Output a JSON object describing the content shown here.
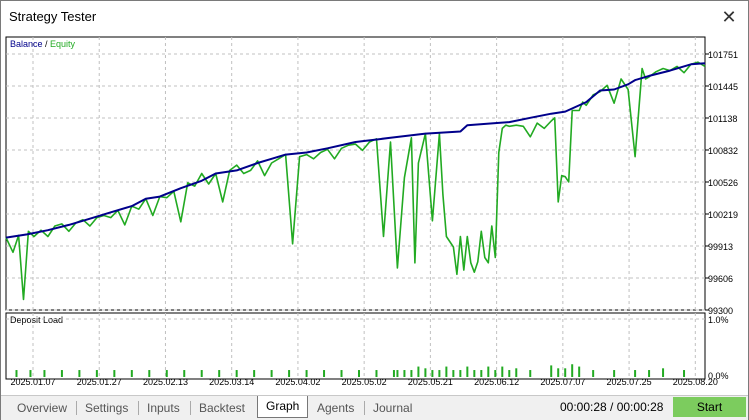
{
  "window": {
    "title": "Strategy Tester",
    "close_glyph": "✕"
  },
  "colors": {
    "balance": "#00008b",
    "equity": "#22aa22",
    "deposit_load": "#22aa22",
    "grid": "#c0c0c0",
    "start_button": "#7ccc5e"
  },
  "tabs": [
    {
      "label": "Overview",
      "active": false
    },
    {
      "label": "Settings",
      "active": false
    },
    {
      "label": "Inputs",
      "active": false
    },
    {
      "label": "Backtest",
      "active": false
    },
    {
      "label": "Graph",
      "active": true
    },
    {
      "label": "Agents",
      "active": false
    },
    {
      "label": "Journal",
      "active": false
    }
  ],
  "status": {
    "timer": "00:00:28 / 00:00:28",
    "start_label": "Start"
  },
  "chart_data": [
    {
      "type": "line",
      "legend": [
        {
          "name": "Balance",
          "color": "#00008b"
        },
        {
          "name": "Equity",
          "color": "#22aa22"
        }
      ],
      "legend_separator": " / ",
      "ylim": [
        99300,
        101900
      ],
      "yticks": [
        "101751",
        "101445",
        "101138",
        "100832",
        "100526",
        "100219",
        "99913",
        "99606",
        "99300"
      ],
      "xticks": [
        "2025.01.07",
        "2025.01.27",
        "2025.02.13",
        "2025.03.14",
        "2025.04.02",
        "2025.05.02",
        "2025.05.21",
        "2025.06.12",
        "2025.07.07",
        "2025.07.25",
        "2025.08.20"
      ],
      "grid": true,
      "xrange": [
        0,
        100
      ],
      "series": [
        {
          "name": "Balance",
          "x": [
            0,
            3,
            6,
            9,
            12,
            15,
            18,
            20,
            22,
            25,
            28,
            30,
            33,
            36,
            38,
            40,
            43,
            46,
            50,
            55,
            60,
            65,
            66,
            70,
            72,
            75,
            78,
            80,
            83,
            85,
            87,
            89,
            90,
            92,
            95,
            98,
            100
          ],
          "values": [
            99990,
            100020,
            100060,
            100110,
            100170,
            100230,
            100290,
            100360,
            100380,
            100460,
            100530,
            100600,
            100630,
            100700,
            100740,
            100780,
            100800,
            100840,
            100900,
            100940,
            100980,
            101000,
            101060,
            101080,
            101090,
            101130,
            101170,
            101190,
            101280,
            101390,
            101400,
            101450,
            101490,
            101530,
            101580,
            101640,
            101650
          ]
        },
        {
          "name": "Equity",
          "x": [
            0,
            1,
            1.8,
            2.5,
            3.2,
            4,
            5,
            6,
            7,
            8,
            9,
            10,
            11,
            12,
            13,
            14,
            15,
            16,
            17,
            18,
            19,
            20,
            21,
            22,
            23,
            24,
            25,
            26,
            27,
            28,
            29,
            30,
            31,
            32,
            33,
            34,
            35,
            36,
            37,
            38,
            39,
            40,
            41,
            42,
            43,
            44,
            45,
            46,
            47,
            48,
            49,
            50,
            51,
            52,
            53,
            54,
            55,
            56,
            57,
            58,
            58.5,
            59,
            60,
            61,
            62,
            62.5,
            63,
            64,
            64.5,
            65,
            65.5,
            66,
            66.5,
            67,
            67.5,
            68,
            68.5,
            69,
            69.5,
            70,
            70.5,
            71,
            71.5,
            72,
            73,
            74,
            75,
            76,
            77,
            78,
            78.5,
            79,
            79.5,
            80,
            80.5,
            81,
            82,
            82.5,
            83,
            84,
            85,
            86,
            87,
            88,
            89,
            90,
            91,
            91.5,
            92,
            93,
            94,
            95,
            96,
            97,
            98,
            99,
            100
          ],
          "values": [
            99990,
            99850,
            100010,
            99400,
            100050,
            100000,
            100060,
            100000,
            100100,
            100120,
            100050,
            100130,
            100160,
            100100,
            100180,
            100200,
            100180,
            100250,
            100110,
            100290,
            100260,
            100360,
            100200,
            100380,
            100370,
            100430,
            100140,
            100510,
            100480,
            100600,
            100500,
            100600,
            100330,
            100630,
            100680,
            100600,
            100630,
            100720,
            100580,
            100700,
            100740,
            100780,
            99930,
            100760,
            100780,
            100740,
            100800,
            100830,
            100740,
            100840,
            100870,
            100880,
            100820,
            100900,
            100930,
            100000,
            100900,
            99700,
            100560,
            100940,
            99750,
            100700,
            100980,
            100150,
            100980,
            100400,
            100000,
            99900,
            99640,
            100000,
            99680,
            100000,
            99750,
            99660,
            99760,
            100050,
            99800,
            99750,
            100100,
            99800,
            100800,
            101030,
            101060,
            101050,
            101060,
            101050,
            100950,
            101080,
            101030,
            101100,
            101130,
            100330,
            100580,
            100570,
            100520,
            101200,
            101200,
            101280,
            101250,
            101350,
            101380,
            101440,
            101270,
            101500,
            101400,
            100760,
            101600,
            101500,
            101520,
            101570,
            101600,
            101580,
            101620,
            101560,
            101640,
            101660,
            101620
          ],
          "color": "#22aa22"
        }
      ]
    },
    {
      "type": "bar",
      "title": "Deposit Load",
      "ylim": [
        0,
        1
      ],
      "yticks": [
        "1.0%",
        "0.0%"
      ],
      "unit": "%",
      "grid": true,
      "x": [
        1.5,
        3.5,
        5.5,
        8,
        10.5,
        13,
        15.5,
        18,
        20.5,
        23,
        25.5,
        28,
        30.5,
        33,
        35.5,
        38,
        40.5,
        43,
        45.5,
        48,
        50.5,
        53,
        55.5,
        56,
        57,
        58,
        59,
        60,
        61,
        62,
        63,
        64,
        65,
        66,
        67,
        68,
        69,
        70,
        71,
        72,
        73,
        75,
        78,
        79,
        80,
        81,
        82,
        84,
        87,
        90,
        92,
        94,
        97
      ],
      "values": [
        0.12,
        0.12,
        0.12,
        0.12,
        0.12,
        0.12,
        0.12,
        0.12,
        0.12,
        0.12,
        0.12,
        0.12,
        0.12,
        0.12,
        0.12,
        0.12,
        0.12,
        0.12,
        0.12,
        0.12,
        0.12,
        0.12,
        0.12,
        0.12,
        0.12,
        0.12,
        0.18,
        0.15,
        0.12,
        0.12,
        0.18,
        0.12,
        0.12,
        0.18,
        0.12,
        0.12,
        0.18,
        0.12,
        0.18,
        0.12,
        0.15,
        0.12,
        0.2,
        0.15,
        0.15,
        0.22,
        0.18,
        0.12,
        0.12,
        0.12,
        0.12,
        0.15,
        0.12
      ]
    }
  ]
}
